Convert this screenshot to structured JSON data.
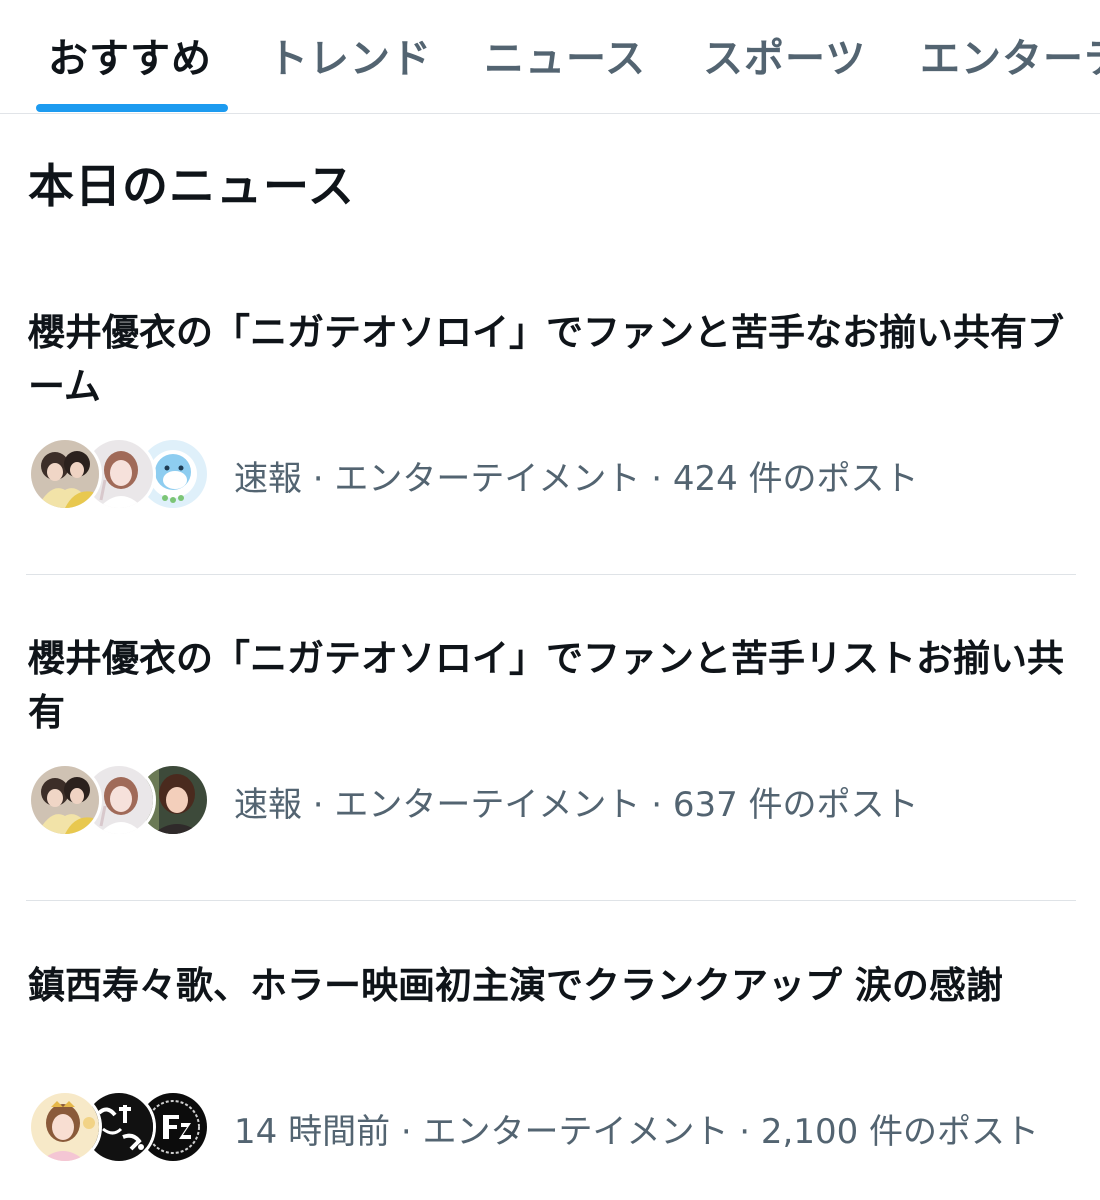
{
  "tabs": [
    {
      "label": "おすすめ",
      "active": true
    },
    {
      "label": "トレンド",
      "active": false
    },
    {
      "label": "ニュース",
      "active": false
    },
    {
      "label": "スポーツ",
      "active": false
    },
    {
      "label": "エンターテ",
      "active": false
    }
  ],
  "section": {
    "title": "本日のニュース"
  },
  "news": [
    {
      "headline": "櫻井優衣の「ニガテオソロイ」でファンと苦手なお揃い共有ブーム",
      "meta": "速報 · エンターテイメント · 424 件のポスト"
    },
    {
      "headline": "櫻井優衣の「ニガテオソロイ」でファンと苦手リストお揃い共有",
      "meta": "速報 · エンターテイメント · 637 件のポスト"
    },
    {
      "headline": "鎮西寿々歌、ホラー映画初主演でクランクアップ 涙の感謝",
      "meta": "14 時間前 · エンターテイメント · 2,100 件のポスト"
    }
  ],
  "colors": {
    "accent": "#1d9bf0",
    "text_primary": "#0f1419",
    "text_secondary": "#536471",
    "divider": "#dfe3e7"
  }
}
